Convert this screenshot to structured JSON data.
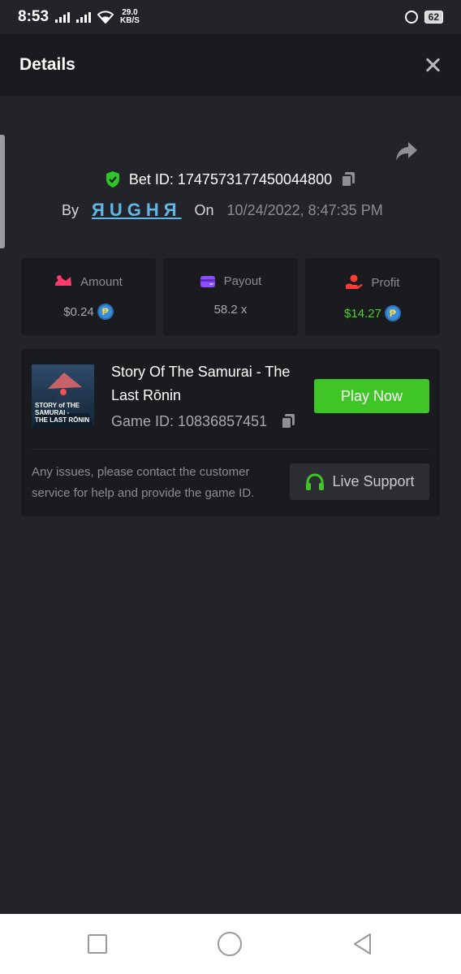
{
  "statusbar": {
    "time": "8:53",
    "speed_value": "29.0",
    "speed_unit": "KB/S",
    "battery": "62"
  },
  "header": {
    "title": "Details"
  },
  "bet": {
    "id_text": "Bet ID: 1747573177450044800",
    "by_label": "By",
    "user_logo": "ЯUGHЯ",
    "on_label": "On",
    "date": "10/24/2022, 8:47:35 PM"
  },
  "stats": {
    "amount": {
      "label": "Amount",
      "value": "$0.24",
      "icon": "bet-amount-icon",
      "color": "#ff3b6b"
    },
    "payout": {
      "label": "Payout",
      "value": "58.2 x",
      "icon": "wallet-icon",
      "color": "#8b4dff"
    },
    "profit": {
      "label": "Profit",
      "value": "$14.27",
      "icon": "hand-coin-icon",
      "color": "#ff3a3a"
    }
  },
  "coin_symbol": "₱",
  "game": {
    "title": "Story Of The Samurai - The Last Rōnin",
    "id_text": "Game ID: 10836857451",
    "thumb_text_line1": "STORY of THE",
    "thumb_text_line2": "SAMURAI -",
    "thumb_text_line3": "THE LAST RŌNIN",
    "play_label": "Play Now",
    "help_text": "Any issues, please contact the customer service for help and provide the game ID.",
    "support_label": "Live Support"
  },
  "colors": {
    "background": "#232429",
    "panel": "#1a1b1f",
    "accent_green": "#3fc526"
  }
}
